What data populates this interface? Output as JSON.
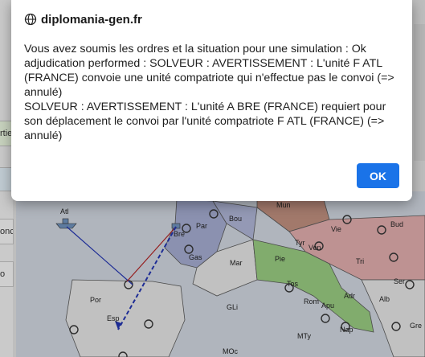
{
  "dialog": {
    "site": "diplomania-gen.fr",
    "line1": "Vous avez soumis les ordres et la situation pour une simulation : Ok adjudication performed : SOLVEUR : AVERTISSEMENT : L'unité F ATL (FRANCE) convoie une unité compatriote qui n'effectue pas le convoi (=> annulé)",
    "line2": "SOLVEUR : AVERTISSEMENT : L'unité A BRE (FRANCE) requiert pour son déplacement le convoi par l'unité compatriote F ATL (FRANCE) (=> annulé)",
    "ok_label": "OK"
  },
  "background": {
    "left_tabs": [
      "rtie",
      "onc",
      "o"
    ],
    "regions": [
      "Atl",
      "Bre",
      "Bou",
      "Mun",
      "Par",
      "Tyr",
      "Ven",
      "Vie",
      "Bud",
      "Gas",
      "Mar",
      "Pie",
      "Tri",
      "Tos",
      "Adr",
      "Ser",
      "Por",
      "Esp",
      "GLi",
      "Rom",
      "Apu",
      "Alb",
      "Gre",
      "Nap",
      "MTy",
      "MOc"
    ]
  },
  "colors": {
    "ok_button": "#1a73e8",
    "france": "#9fa6c9",
    "germany": "#b98a7a",
    "austria": "#d9a7a7",
    "italy": "#93c47d",
    "sea": "#c9cfd8",
    "neutral": "#dcdcdc"
  }
}
